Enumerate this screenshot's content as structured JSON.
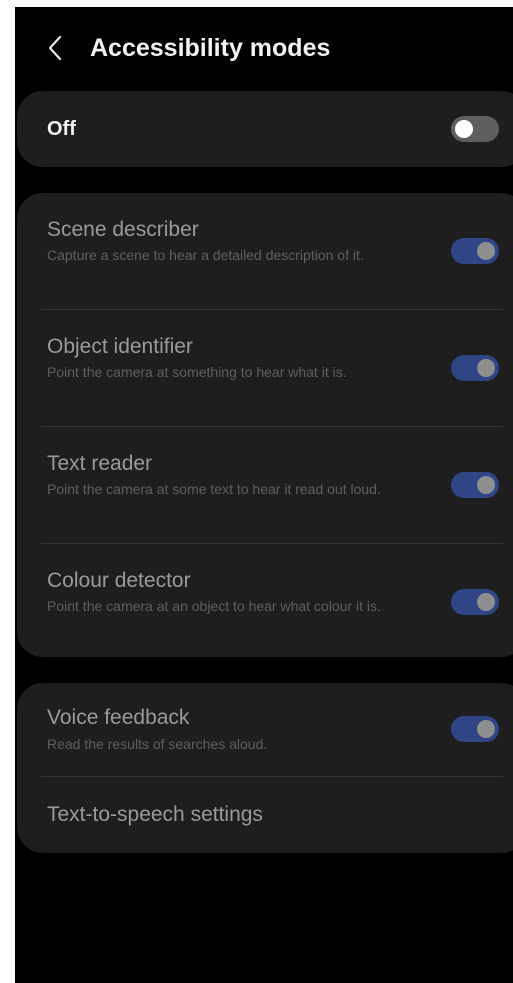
{
  "header": {
    "title": "Accessibility modes",
    "back_icon": "chevron-left-icon"
  },
  "master": {
    "label": "Off",
    "enabled": false
  },
  "modes": [
    {
      "title": "Scene describer",
      "description": "Capture a scene to hear a detailed description of it.",
      "enabled": true
    },
    {
      "title": "Object identifier",
      "description": "Point the camera at something to hear what it is.",
      "enabled": true
    },
    {
      "title": "Text reader",
      "description": "Point the camera at some text to hear it read out loud.",
      "enabled": true
    },
    {
      "title": "Colour detector",
      "description": "Point the camera at an object to hear what colour it is.",
      "enabled": true
    }
  ],
  "feedback": {
    "voice_title": "Voice feedback",
    "voice_description": "Read the results of searches aloud.",
    "voice_enabled": true,
    "tts_label": "Text-to-speech settings"
  },
  "colors": {
    "background": "#000000",
    "card": "#1e1e1e",
    "toggle_on_track": "#2f4585",
    "toggle_off_track": "#5e5e5e",
    "title_text": "#f2f2f2",
    "dimmed_text": "#9a9a9a",
    "description_text": "#5f5f5f"
  }
}
